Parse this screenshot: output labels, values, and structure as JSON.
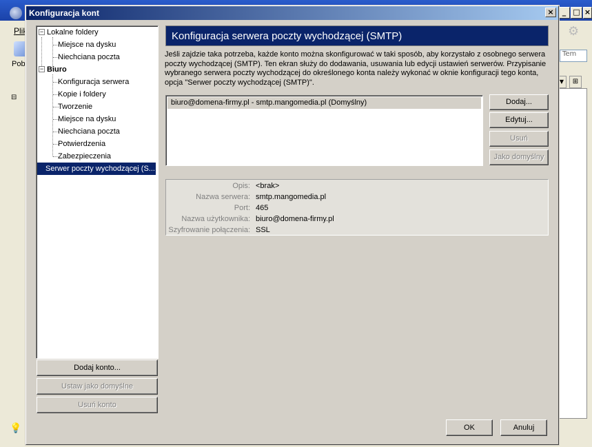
{
  "background_app": {
    "menu_file": "Plik",
    "toolbar_label": "Pob",
    "search_placeholder": "Tem",
    "icons": [
      "thunderbird-icon",
      "gear-icon",
      "search-icon",
      "lightbulb-icon"
    ]
  },
  "dialog": {
    "title": "Konfiguracja kont",
    "close_label": "×"
  },
  "tree": {
    "groups": [
      {
        "label": "Lokalne foldery",
        "items": [
          "Miejsce na dysku",
          "Niechciana poczta"
        ]
      },
      {
        "label": "Biuro",
        "items": [
          "Konfiguracja serwera",
          "Kopie i foldery",
          "Tworzenie",
          "Miejsce na dysku",
          "Niechciana poczta",
          "Potwierdzenia",
          "Zabezpieczenia"
        ]
      }
    ],
    "selected": "Serwer poczty wychodzącej (S..."
  },
  "left_buttons": {
    "add_account": "Dodaj konto...",
    "set_default": "Ustaw jako domyślne",
    "remove_account": "Usuń konto"
  },
  "panel": {
    "header": "Konfiguracja serwera poczty wychodzącej (SMTP)",
    "description": "Jeśli zajdzie taka potrzeba, każde konto można skonfigurować w taki sposób, aby korzystało z osobnego serwera poczty wychodzącej (SMTP). Ten ekran służy do dodawania, usuwania lub edycji ustawień serwerów. Przypisanie wybranego serwera poczty wychodzącej do określonego konta należy wykonać w oknie konfiguracji tego konta, opcja \"Serwer poczty wychodzącej (SMTP)\".",
    "servers": [
      "biuro@domena-firmy.pl - smtp.mangomedia.pl (Domyślny)"
    ],
    "buttons": {
      "add": "Dodaj...",
      "edit": "Edytuj...",
      "remove": "Usuń",
      "set_default": "Jako domyślny"
    },
    "details": {
      "description_label": "Opis:",
      "description_value": "<brak>",
      "server_label": "Nazwa serwera:",
      "server_value": "smtp.mangomedia.pl",
      "port_label": "Port:",
      "port_value": "465",
      "user_label": "Nazwa użytkownika:",
      "user_value": "biuro@domena-firmy.pl",
      "encryption_label": "Szyfrowanie połączenia:",
      "encryption_value": "SSL"
    }
  },
  "footer": {
    "ok": "OK",
    "cancel": "Anuluj"
  }
}
